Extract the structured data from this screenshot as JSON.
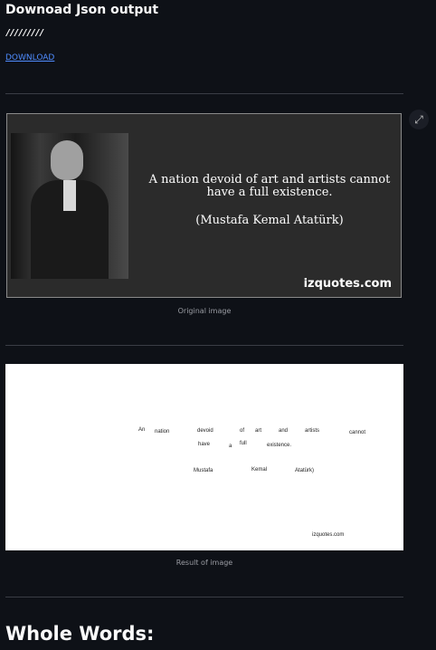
{
  "header": {
    "title": "Downoad Json output",
    "stars": "/////////",
    "download_label": "DOWNLOAD"
  },
  "original_image": {
    "quote": "A nation devoid of art and artists cannot have a full existence.",
    "author": "(Mustafa Kemal Atatürk)",
    "site": "izquotes.com",
    "caption": "Original image"
  },
  "result_image": {
    "words": [
      "An",
      "nation",
      "devoid",
      "of",
      "art",
      "and",
      "artists",
      "cannot",
      "have",
      "a",
      "full",
      "existence.",
      "Mustafa",
      "Kemal",
      "Atatürk)",
      "izquotes.com"
    ],
    "caption": "Result of image"
  },
  "section": {
    "title": "Whole Words:"
  },
  "icons": {
    "expand": "expand-icon"
  }
}
